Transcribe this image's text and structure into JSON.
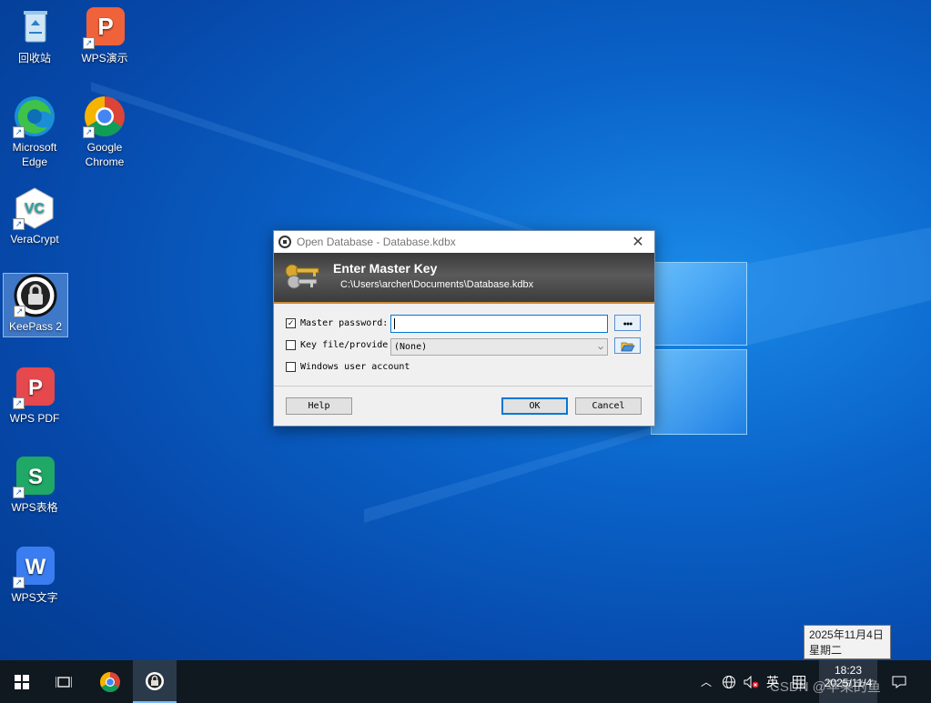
{
  "desktop": {
    "icons": [
      {
        "label": "回收站"
      },
      {
        "label": "WPS演示"
      },
      {
        "label": "Microsoft Edge"
      },
      {
        "label": "Google Chrome"
      },
      {
        "label": "VeraCrypt"
      },
      {
        "label": "KeePass 2"
      },
      {
        "label": "WPS PDF"
      },
      {
        "label": "WPS表格"
      },
      {
        "label": "WPS文字"
      }
    ]
  },
  "dialog": {
    "title": "Open Database - Database.kdbx",
    "close_glyph": "✕",
    "banner_title": "Enter Master Key",
    "banner_path": "C:\\Users\\archer\\Documents\\Database.kdbx",
    "master_password_label": "Master password:",
    "master_password_checked": true,
    "master_password_value": "",
    "show_password_glyph": "●●●",
    "key_file_label": "Key file/provider:",
    "key_file_checked": false,
    "key_file_value": "(None)",
    "windows_account_label": "Windows user account",
    "windows_account_checked": false,
    "help_label": "Help",
    "ok_label": "OK",
    "cancel_label": "Cancel"
  },
  "taskbar": {
    "tray_ime": "英",
    "tray_grid": "拼",
    "time": "18:23",
    "date": "2025/11/4",
    "tooltip_date": "2025年11月4日",
    "tooltip_weekday": "星期二",
    "watermark": "CSDN @苹果的鱼"
  },
  "colors": {
    "accent": "#0078d7",
    "banner_bottom": "#c98a3a",
    "taskbar": "#101820"
  }
}
